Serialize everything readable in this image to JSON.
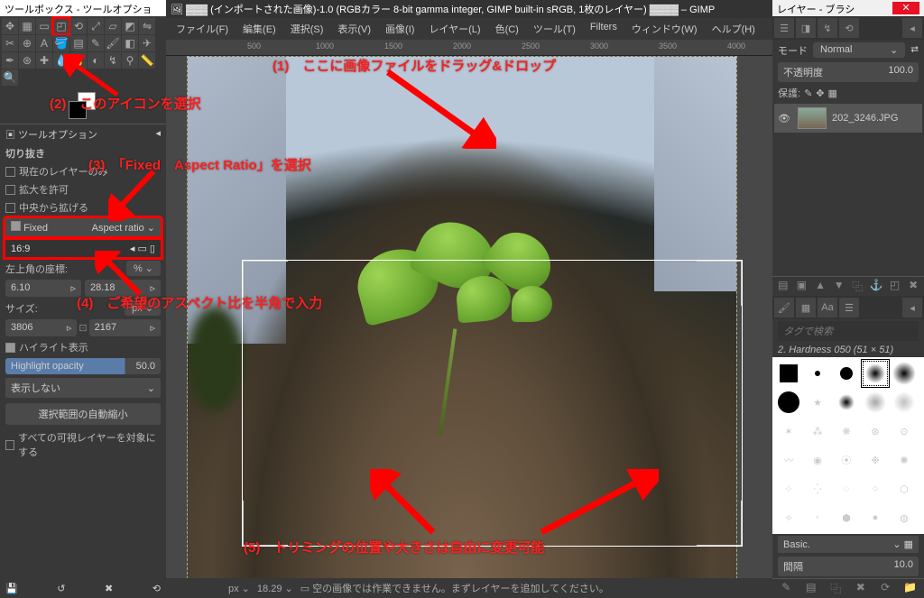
{
  "left": {
    "title": "ツールボックス - ツールオプション",
    "tool_options_hdr": "ツールオプション",
    "crop_hdr": "切り抜き",
    "opt1": "現在のレイヤーのみ",
    "opt2": "拡大を許可",
    "opt3": "中央から拡げる",
    "fixed": "Fixed",
    "aspect": "Aspect ratio",
    "ratio": "16:9",
    "pos_label": "左上角の座標:",
    "pct": "%",
    "xval": "6.10",
    "yval": "28.18",
    "size_label": "サイズ:",
    "px": "px",
    "w": "3806",
    "h": "2167",
    "hl_chk": "ハイライト表示",
    "hl_label": "Highlight opacity",
    "hl_val": "50.0",
    "noshow": "表示しない",
    "autoshrink": "選択範囲の自動縮小",
    "all_layers": "すべての可視レイヤーを対象にする"
  },
  "center": {
    "title_pre": "(インポートされた画像)-1.0 (RGBカラー 8-bit gamma integer, GIMP built-in sRGB, 1枚のレイヤー)",
    "title_suf": "– GIMP",
    "menu": [
      "ファイル(F)",
      "編集(E)",
      "選択(S)",
      "表示(V)",
      "画像(I)",
      "レイヤー(L)",
      "色(C)",
      "ツール(T)",
      "Filters",
      "ウィンドウ(W)",
      "ヘルプ(H)"
    ],
    "ruler": [
      "500",
      "1000",
      "1500",
      "2000",
      "2500",
      "3000",
      "3500",
      "4000"
    ],
    "status_px": "px",
    "status_zoom": "18.29",
    "status_msg": "空の画像では作業できません。まずレイヤーを追加してください。",
    "annot1": "(1)　ここに画像ファイルをドラッグ&ドロップ",
    "annot2": "(2)　このアイコンを選択",
    "annot3": "(3)　「Fixed　Aspect Ratio」を選択",
    "annot4": "(4)　ご希望のアスペクト比を半角で入力",
    "annot5": "(5)　トリミングの位置や大きさは自由に変更可能"
  },
  "right": {
    "title": "レイヤー - ブラシ",
    "mode": "モード",
    "normal": "Normal",
    "opacity": "不透明度",
    "opacity_val": "100.0",
    "lock": "保護:",
    "layer_name": "202_3246.JPG",
    "tag_search": "タグで検索",
    "brush_name": "2. Hardness 050 (51 × 51)",
    "basic": "Basic.",
    "spacing": "間隔",
    "spacing_val": "10.0"
  }
}
